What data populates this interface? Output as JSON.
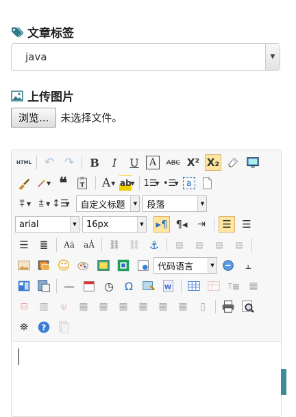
{
  "tags_section": {
    "title": "文章标签",
    "icon": "tag-icon"
  },
  "tag_select": {
    "value": "java"
  },
  "upload_section": {
    "title": "上传图片",
    "icon": "image-icon"
  },
  "file_input": {
    "button_label": "浏览...",
    "status": "未选择文件。"
  },
  "editor": {
    "font_family": "arial",
    "font_size": "16px",
    "custom_heading": "自定义标题",
    "paragraph": "段落",
    "code_language": "代码语言"
  },
  "colors": {
    "accent": "#3c8d99",
    "active": "#ffe69f"
  }
}
